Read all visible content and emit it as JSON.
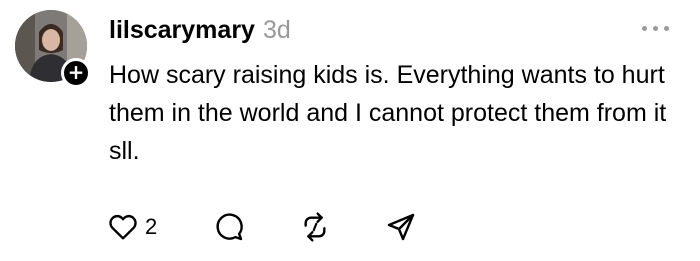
{
  "post": {
    "username": "lilscarymary",
    "timestamp": "3d",
    "text": "How scary raising kids is. Everything wants to hurt them in the world and I cannot protect them from it sll.",
    "avatar_badge": "+",
    "more_icon": "more-horizontal-icon"
  },
  "actions": {
    "like_count": "2",
    "icons": [
      "heart-icon",
      "comment-icon",
      "repost-icon",
      "share-icon"
    ]
  },
  "colors": {
    "text": "#000000",
    "muted": "#999999",
    "badge": "#000000"
  }
}
